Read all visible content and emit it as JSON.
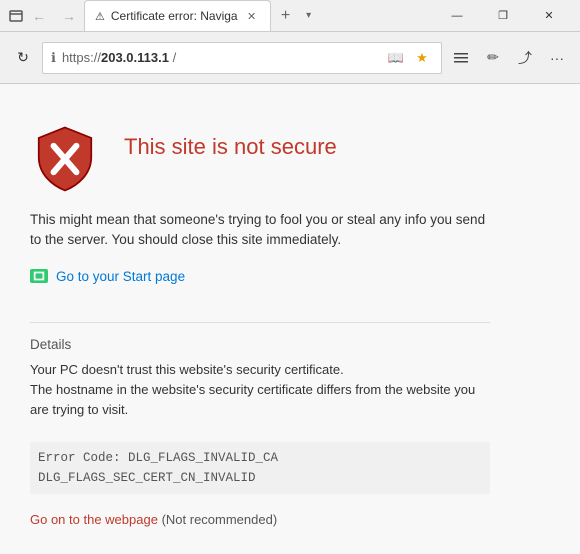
{
  "titlebar": {
    "tab_title": "Certificate error: Naviga",
    "tab_favicon": "⚠",
    "new_tab_label": "+",
    "dropdown_label": "▾",
    "minimize_label": "—",
    "restore_label": "❐",
    "close_label": "✕"
  },
  "addressbar": {
    "back_icon": "←",
    "forward_icon": "→",
    "refresh_icon": "↻",
    "url": "https://  203.0.113.1  /",
    "url_display": "https://",
    "url_bold": "203.0.113.1",
    "url_suffix": "/",
    "lock_icon": "ℹ",
    "read_icon": "📖",
    "star_icon": "★",
    "hub_icon": "☰",
    "pen_icon": "✏",
    "share_icon": "⤴",
    "more_icon": "···"
  },
  "error_page": {
    "title": "This site is not secure",
    "description": "This might mean that someone's trying to fool you or steal any info you send to the server. You should close this site immediately.",
    "start_page_link": "Go to your Start page",
    "details_label": "Details",
    "details_text_line1": "Your PC doesn't trust this website's security certificate.",
    "details_text_line2": "The hostname in the website's security certificate differs from the website you are trying to visit.",
    "error_code_line1": "Error Code:  DLG_FLAGS_INVALID_CA",
    "error_code_line2": "DLG_FLAGS_SEC_CERT_CN_INVALID",
    "go_on_link": "Go on to the webpage",
    "go_on_note": "(Not recommended)"
  },
  "colors": {
    "error_red": "#c0392b",
    "link_blue": "#0078d7",
    "shield_red": "#c0392b",
    "shield_border": "#8B0000"
  }
}
